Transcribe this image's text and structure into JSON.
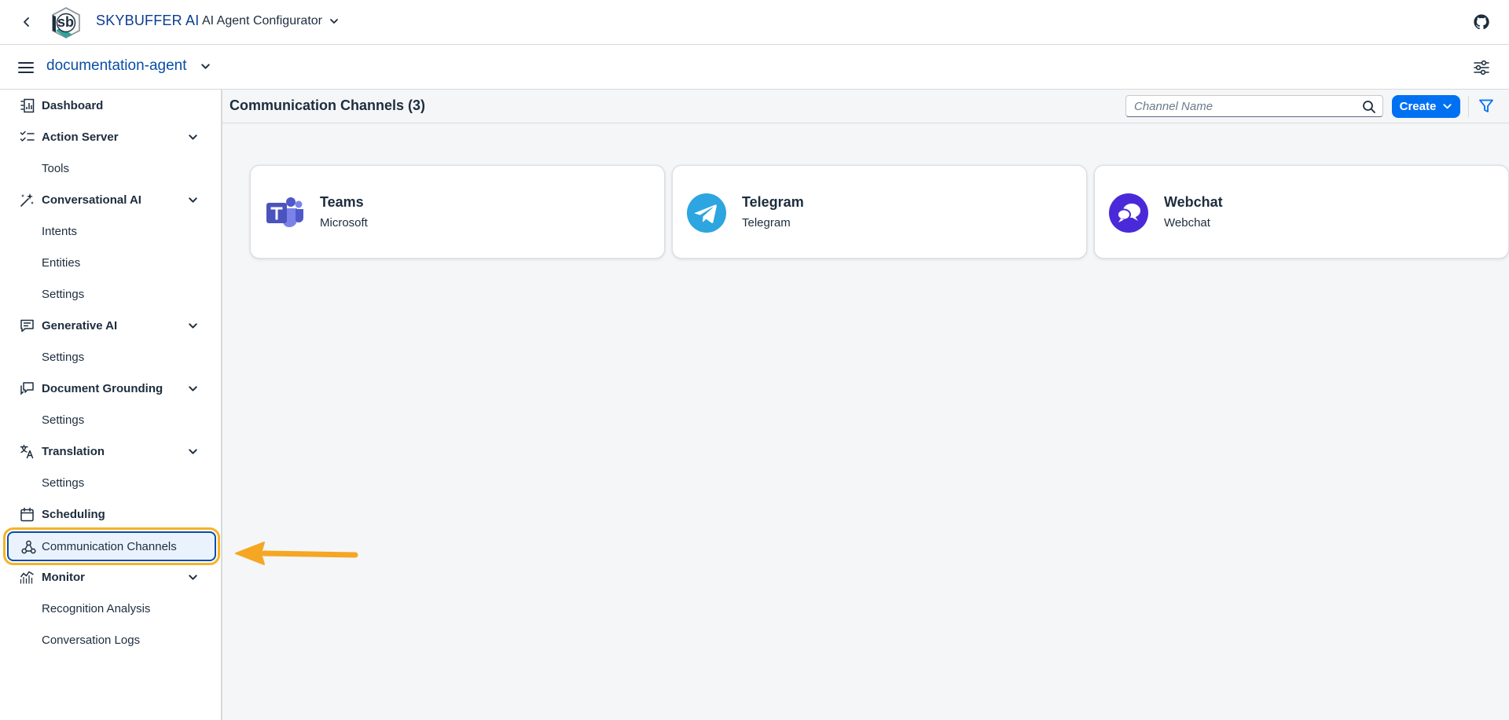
{
  "shellbar": {
    "brand": "SKYBUFFER AI",
    "app_menu_label": "AI Agent Configurator"
  },
  "subheader": {
    "agent_name": "documentation-agent"
  },
  "sidebar": {
    "items": [
      {
        "label": "Dashboard",
        "icon": "dashboard-icon"
      },
      {
        "label": "Action Server",
        "icon": "checklist-icon",
        "expanded": true
      },
      {
        "label": "Tools"
      },
      {
        "label": "Conversational AI",
        "icon": "sparkle-icon",
        "expanded": true
      },
      {
        "label": "Intents"
      },
      {
        "label": "Entities"
      },
      {
        "label": "Settings"
      },
      {
        "label": "Generative AI",
        "icon": "chat-bubble-icon",
        "expanded": true
      },
      {
        "label": "Settings"
      },
      {
        "label": "Document Grounding",
        "icon": "document-chat-icon",
        "expanded": true
      },
      {
        "label": "Settings"
      },
      {
        "label": "Translation",
        "icon": "translate-icon",
        "expanded": true
      },
      {
        "label": "Settings"
      },
      {
        "label": "Scheduling",
        "icon": "calendar-icon"
      },
      {
        "label": "Communication Channels",
        "icon": "network-icon",
        "selected": true
      },
      {
        "label": "Monitor",
        "icon": "chart-line-icon",
        "expanded": true
      },
      {
        "label": "Recognition Analysis"
      },
      {
        "label": "Conversation Logs"
      }
    ]
  },
  "main": {
    "title": "Communication Channels (3)",
    "search_placeholder": "Channel Name",
    "create_label": "Create",
    "cards": [
      {
        "title": "Teams",
        "subtitle": "Microsoft",
        "icon": "teams-icon"
      },
      {
        "title": "Telegram",
        "subtitle": "Telegram",
        "icon": "telegram-icon"
      },
      {
        "title": "Webchat",
        "subtitle": "Webchat",
        "icon": "webchat-icon"
      }
    ]
  },
  "colors": {
    "brand_blue": "#0a4ea6",
    "action_blue": "#0070f2",
    "highlight_orange": "#f5b326"
  }
}
